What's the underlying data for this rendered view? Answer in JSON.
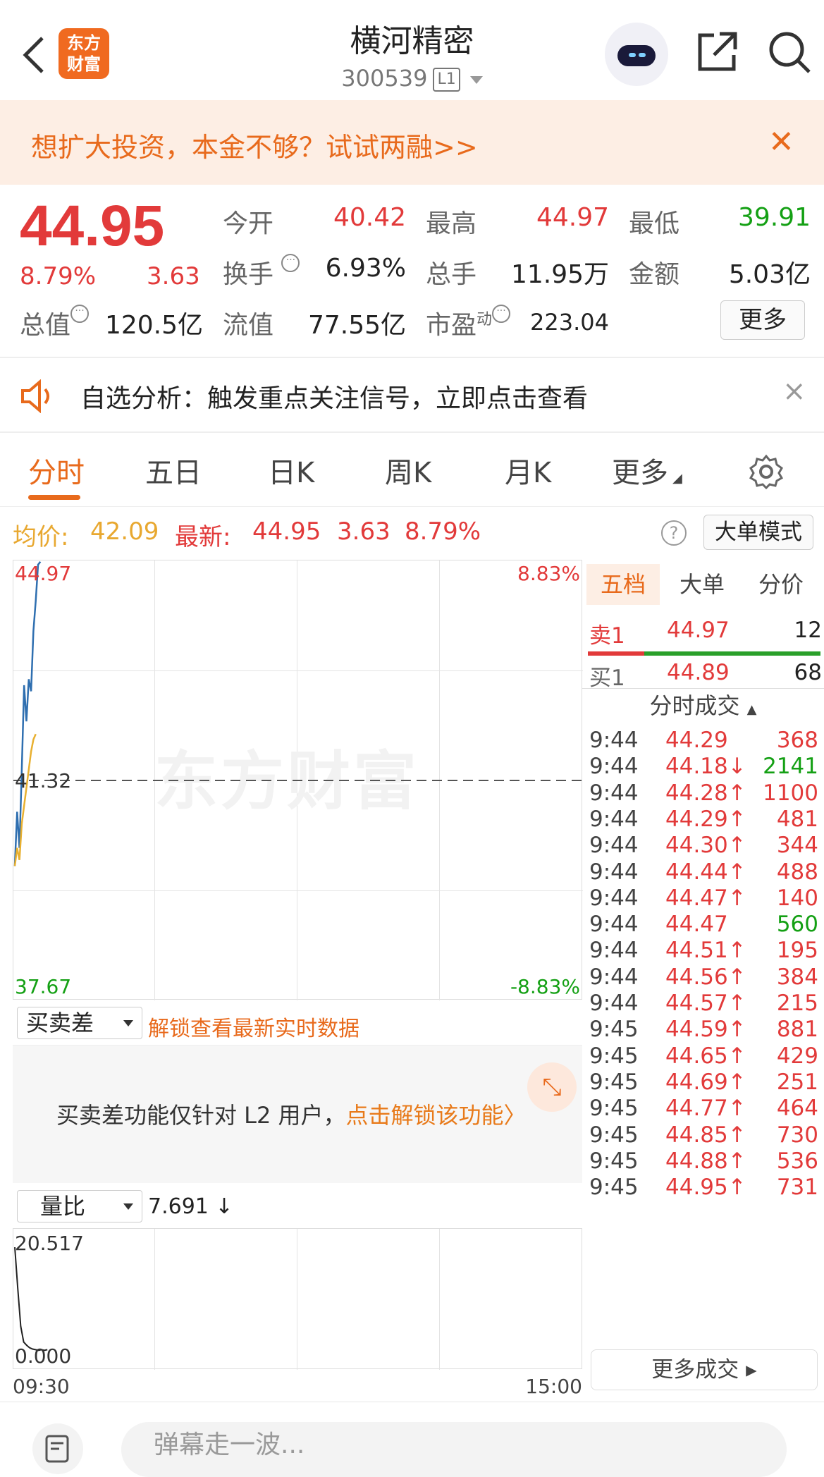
{
  "header": {
    "back": "back",
    "logo_line1": "东方",
    "logo_line2": "财富",
    "title": "横河精密",
    "code": "300539",
    "level": "L1"
  },
  "promo": {
    "text": "想扩大投资，本金不够？试试两融>>",
    "close": "✕"
  },
  "quote": {
    "price": "44.95",
    "change_pct": "8.79%",
    "change": "3.63",
    "open_label": "今开",
    "open": "40.42",
    "high_label": "最高",
    "high": "44.97",
    "low_label": "最低",
    "low": "39.91",
    "turnover_label": "换手",
    "turnover": "6.93%",
    "volume_label": "总手",
    "volume": "11.95万",
    "amount_label": "金额",
    "amount": "5.03亿",
    "mktcap_label": "总值",
    "mktcap": "120.5亿",
    "float_label": "流值",
    "float": "77.55亿",
    "pe_label": "市盈",
    "pe_sup": "动",
    "pe": "223.04",
    "more": "更多"
  },
  "alert": {
    "text": "自选分析：触发重点关注信号，立即点击查看",
    "close": "×"
  },
  "tabs": [
    "分时",
    "五日",
    "日K",
    "周K",
    "月K",
    "更多"
  ],
  "info": {
    "avg_label": "均价:",
    "avg": "42.09",
    "latest_label": "最新:",
    "latest": "44.95",
    "latest_chg": "3.63",
    "latest_pct": "8.79%",
    "help": "?",
    "mode_button": "大单模式"
  },
  "chart": {
    "top_left": "44.97",
    "top_right": "8.83%",
    "mid_left": "41.32",
    "bottom_left": "37.67",
    "bottom_right": "-8.83%",
    "watermark": "东方财富"
  },
  "chart_data": {
    "type": "line",
    "ylim": [
      37.67,
      44.97
    ],
    "y_mid": 41.32,
    "series": [
      {
        "color": "#2f6fb0",
        "values": [
          39.9,
          40.8,
          40.2,
          41.5,
          42.9,
          42.3,
          43.0,
          42.8,
          43.8,
          44.3,
          44.9,
          44.95
        ]
      },
      {
        "color": "#e8b030",
        "values": [
          39.9,
          40.2,
          40.0,
          40.6,
          40.9,
          41.2,
          41.5,
          41.8,
          42.0,
          42.09
        ]
      }
    ],
    "volume_ratio": {
      "ylim": [
        0.0,
        20.517
      ],
      "values": [
        18.5,
        12,
        6,
        3.5,
        3,
        2.6,
        2.4,
        2.3,
        2.2,
        2.3,
        2.2,
        2.3
      ]
    }
  },
  "orderbook": {
    "tabs": [
      "五档",
      "大单",
      "分价"
    ],
    "ask_label": "卖1",
    "ask_price": "44.97",
    "ask_vol": "12",
    "bid_label": "买1",
    "bid_price": "44.89",
    "bid_vol": "68"
  },
  "trades": {
    "header": "分时成交",
    "rows": [
      {
        "time": "9:44",
        "price": "44.29",
        "vol": "368",
        "dir": "",
        "vc": "red"
      },
      {
        "time": "9:44",
        "price": "44.18↓",
        "vol": "2141",
        "dir": "",
        "vc": "green"
      },
      {
        "time": "9:44",
        "price": "44.28↑",
        "vol": "1100",
        "dir": "",
        "vc": "red"
      },
      {
        "time": "9:44",
        "price": "44.29↑",
        "vol": "481",
        "dir": "",
        "vc": "red"
      },
      {
        "time": "9:44",
        "price": "44.30↑",
        "vol": "344",
        "dir": "",
        "vc": "red"
      },
      {
        "time": "9:44",
        "price": "44.44↑",
        "vol": "488",
        "dir": "",
        "vc": "red"
      },
      {
        "time": "9:44",
        "price": "44.47↑",
        "vol": "140",
        "dir": "",
        "vc": "red"
      },
      {
        "time": "9:44",
        "price": "44.47",
        "vol": "560",
        "dir": "",
        "vc": "green"
      },
      {
        "time": "9:44",
        "price": "44.51↑",
        "vol": "195",
        "dir": "",
        "vc": "red"
      },
      {
        "time": "9:44",
        "price": "44.56↑",
        "vol": "384",
        "dir": "",
        "vc": "red"
      },
      {
        "time": "9:44",
        "price": "44.57↑",
        "vol": "215",
        "dir": "",
        "vc": "red"
      },
      {
        "time": "9:45",
        "price": "44.59↑",
        "vol": "881",
        "dir": "",
        "vc": "red"
      },
      {
        "time": "9:45",
        "price": "44.65↑",
        "vol": "429",
        "dir": "",
        "vc": "red"
      },
      {
        "time": "9:45",
        "price": "44.69↑",
        "vol": "251",
        "dir": "",
        "vc": "red"
      },
      {
        "time": "9:45",
        "price": "44.77↑",
        "vol": "464",
        "dir": "",
        "vc": "red"
      },
      {
        "time": "9:45",
        "price": "44.85↑",
        "vol": "730",
        "dir": "",
        "vc": "red"
      },
      {
        "time": "9:45",
        "price": "44.88↑",
        "vol": "536",
        "dir": "",
        "vc": "red"
      },
      {
        "time": "9:45",
        "price": "44.95↑",
        "vol": "731",
        "dir": "",
        "vc": "red"
      }
    ],
    "more": "更多成交 ▸"
  },
  "diff": {
    "select": "买卖差",
    "unlock": "解锁查看最新实时数据",
    "msg": "买卖差功能仅针对 L2 用户，",
    "msg_link": "点击解锁该功能〉"
  },
  "volume": {
    "select": "量比",
    "value": "7.691 ↓",
    "top": "20.517",
    "bottom": "0.000",
    "t_start": "09:30",
    "t_end": "15:00"
  },
  "bottom": {
    "placeholder": "弹幕走一波..."
  }
}
